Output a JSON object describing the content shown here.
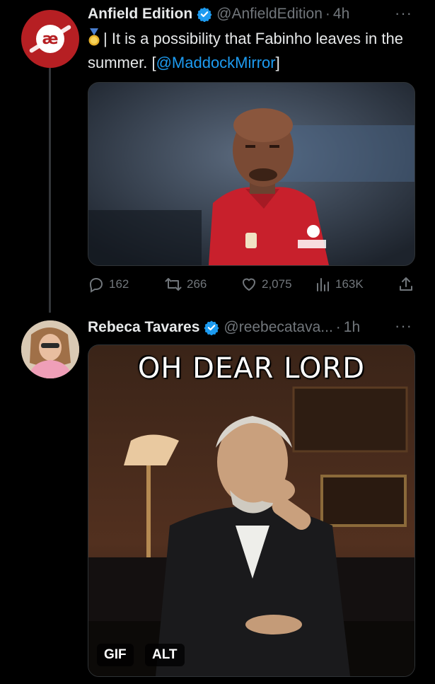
{
  "tweets": [
    {
      "author": "Anfield Edition",
      "handle": "@AnfieldEdition",
      "separator": "·",
      "time": "4h",
      "avatar_icon": "anfield-edition-logo",
      "avatar_text": "æ",
      "text_prefix": "| It is a possibility that Fabinho leaves in the summer. [",
      "mention": "@MaddockMirror",
      "text_suffix": "]",
      "counts": {
        "replies": "162",
        "retweets": "266",
        "likes": "2,075",
        "views": "163K"
      }
    },
    {
      "author": "Rebeca Tavares",
      "handle": "@reebecatava...",
      "separator": "·",
      "time": "1h",
      "media_caption": "OH DEAR LORD",
      "badges": [
        "GIF",
        "ALT"
      ]
    }
  ],
  "more_glyph": "···",
  "colors": {
    "background": "#000000",
    "text": "#e7e9ea",
    "muted": "#71767b",
    "link": "#1d9bf0",
    "verified": "#1d9bf0",
    "brand_red": "#b61f23"
  }
}
